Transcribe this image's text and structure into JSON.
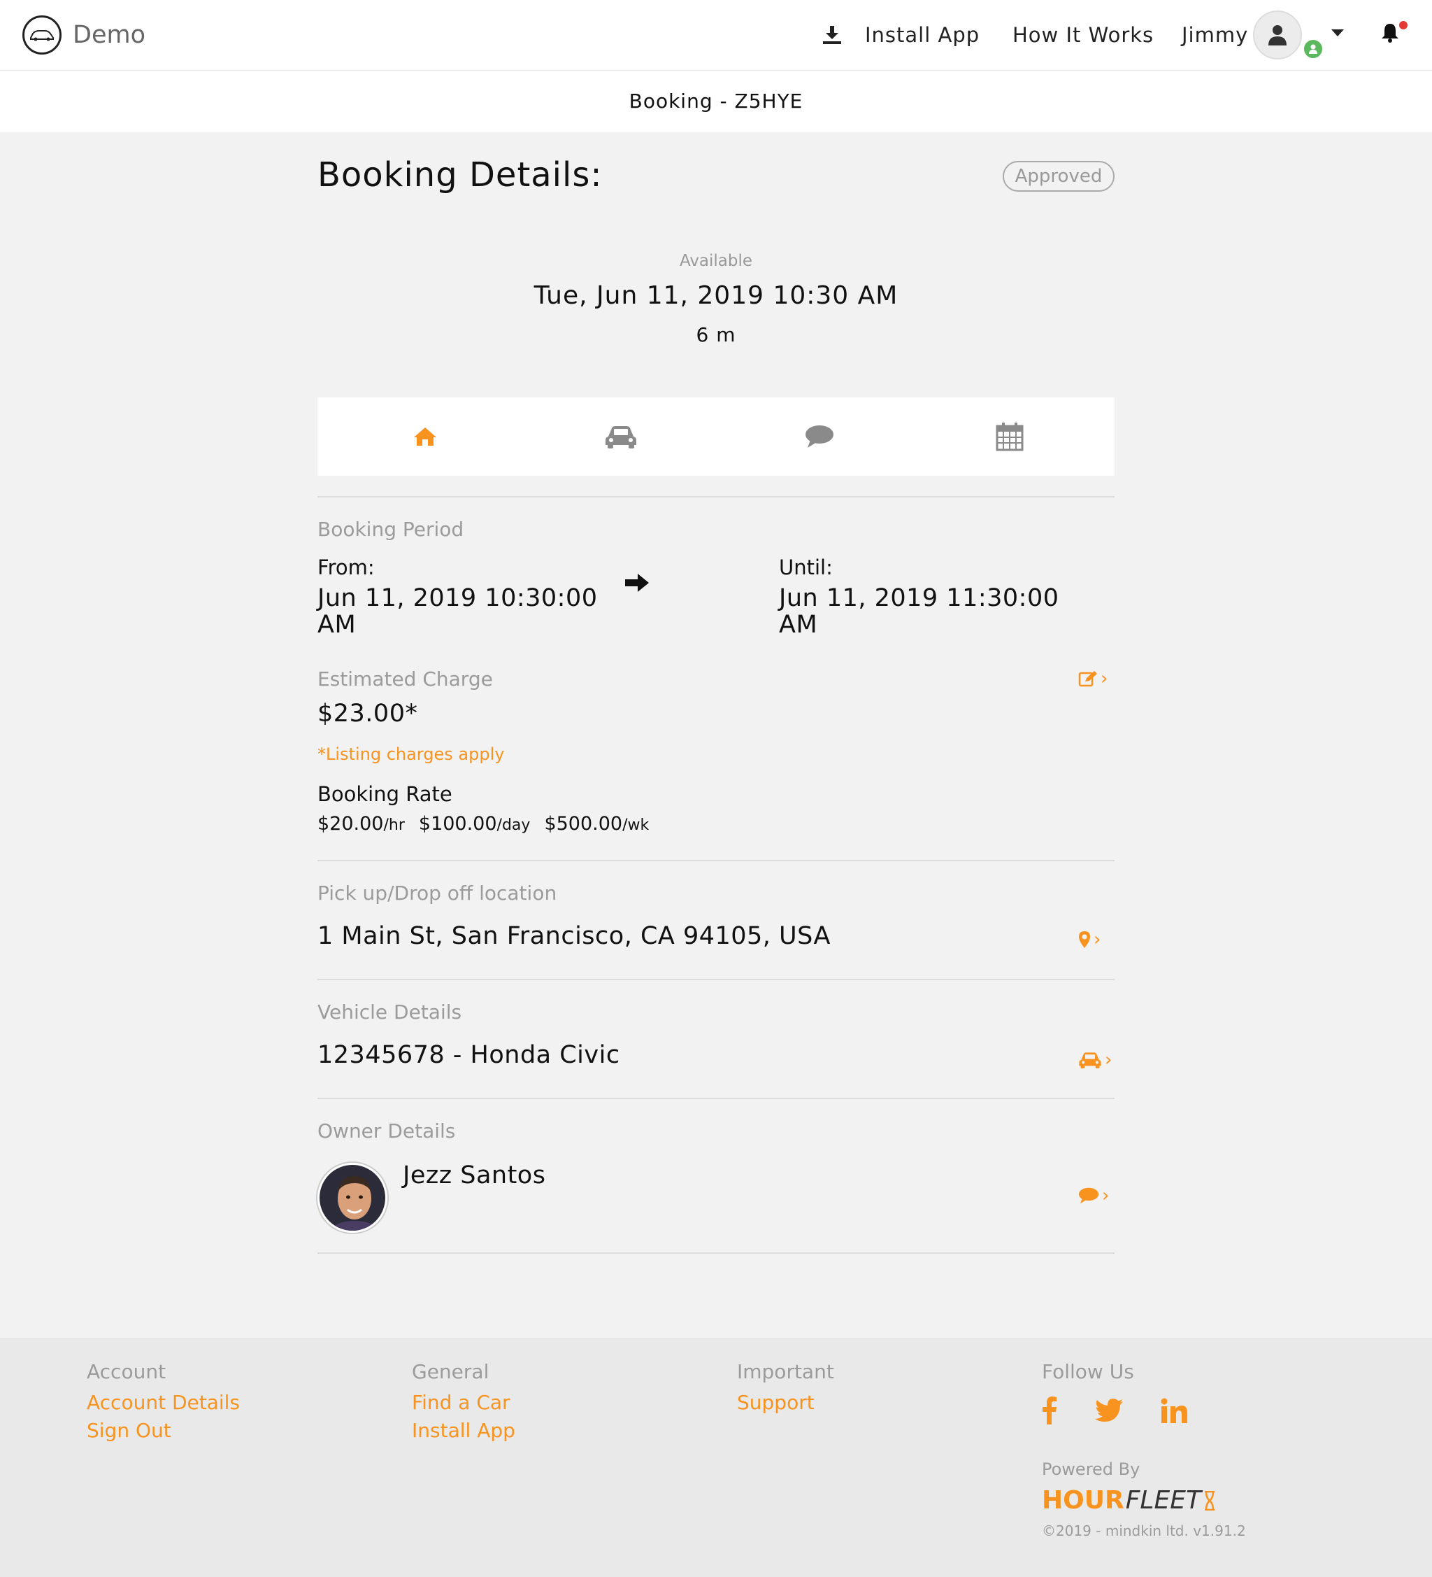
{
  "nav": {
    "brand": "Demo",
    "install_app": "Install App",
    "how_it_works": "How It Works",
    "user_name": "Jimmy"
  },
  "subheader": {
    "title": "Booking - Z5HYE"
  },
  "booking": {
    "title": "Booking Details:",
    "status": "Approved",
    "available_label": "Available",
    "available_date": "Tue, Jun 11, 2019 10:30 AM",
    "available_duration": "6 m"
  },
  "tabs": [
    {
      "icon": "home-icon",
      "active": true
    },
    {
      "icon": "car-icon",
      "active": false
    },
    {
      "icon": "chat-icon",
      "active": false
    },
    {
      "icon": "calendar-icon",
      "active": false
    }
  ],
  "period": {
    "label": "Booking Period",
    "from_label": "From:",
    "from_value": "Jun 11, 2019 10:30:00 AM",
    "until_label": "Until:",
    "until_value": "Jun 11, 2019 11:30:00 AM"
  },
  "charge": {
    "label": "Estimated Charge",
    "value": "$23.00*",
    "note": "*Listing charges apply",
    "rate_label": "Booking Rate",
    "rates": [
      {
        "amount": "$20.00",
        "unit": "/hr"
      },
      {
        "amount": "$100.00",
        "unit": "/day"
      },
      {
        "amount": "$500.00",
        "unit": "/wk"
      }
    ]
  },
  "location": {
    "label": "Pick up/Drop off location",
    "value": "1 Main St, San Francisco, CA 94105, USA"
  },
  "vehicle": {
    "label": "Vehicle Details",
    "value": "12345678 - Honda Civic"
  },
  "owner": {
    "label": "Owner Details",
    "name": "Jezz Santos"
  },
  "footer": {
    "account_head": "Account",
    "account_details": "Account Details",
    "sign_out": "Sign Out",
    "general_head": "General",
    "find_car": "Find a Car",
    "install_app": "Install App",
    "important_head": "Important",
    "support": "Support",
    "follow_head": "Follow Us",
    "powered_by": "Powered By",
    "logo_hour": "HOUR",
    "logo_fleet": "FLEET",
    "copyright": "©2019 - mindkin ltd. v1.91.2"
  },
  "colors": {
    "accent": "#f7931e",
    "muted": "#9b9b9b",
    "online": "#5cb85c",
    "alert": "#e53935"
  }
}
